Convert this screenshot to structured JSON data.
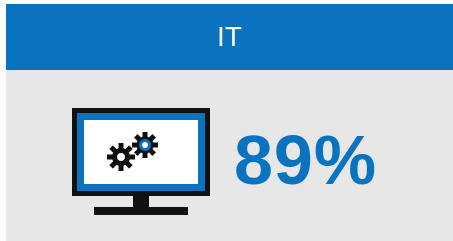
{
  "card": {
    "title": "IT",
    "value": "89%",
    "icon": "monitor-gears-icon"
  },
  "colors": {
    "accent": "#0a73bf",
    "panel": "#e7e7e7",
    "icon_dark": "#111111",
    "screen": "#ffffff"
  }
}
